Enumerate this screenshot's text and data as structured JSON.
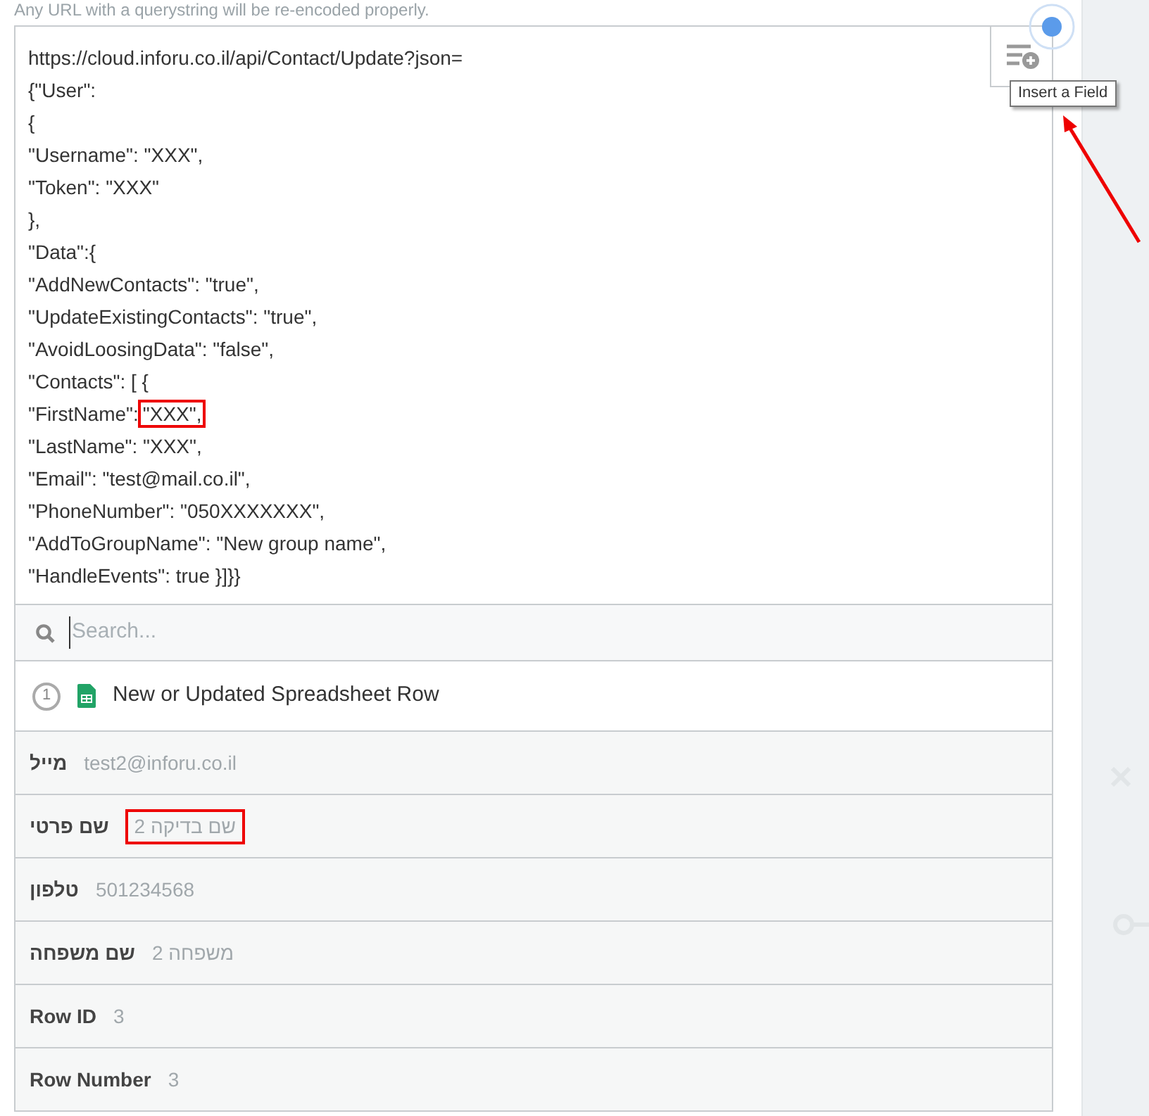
{
  "hint": "Any URL with a querystring will be re-encoded properly.",
  "editor": {
    "lines": [
      {
        "text": "https://cloud.inforu.co.il/api/Contact/Update?json="
      },
      {
        "text": "{\"User\":"
      },
      {
        "text": "{"
      },
      {
        "text": "\"Username\": \"XXX\","
      },
      {
        "text": "\"Token\": \"XXX\""
      },
      {
        "text": "},"
      },
      {
        "text": "\"Data\":{"
      },
      {
        "text": "\"AddNewContacts\": \"true\","
      },
      {
        "text": "\"UpdateExistingContacts\": \"true\","
      },
      {
        "text": "\"AvoidLoosingData\": \"false\","
      },
      {
        "text": "\"Contacts\": [ {"
      },
      {
        "text": "\"FirstName\":",
        "highlight": "\"XXX\","
      },
      {
        "text": "\"LastName\": \"XXX\","
      },
      {
        "text": "\"Email\": \"test@mail.co.il\","
      },
      {
        "text": "\"PhoneNumber\": \"050XXXXXXX\","
      },
      {
        "text": "\"AddToGroupName\": \"New group name\","
      },
      {
        "text": "\"HandleEvents\": true }]}}"
      }
    ],
    "tooltip": "Insert a Field"
  },
  "search": {
    "placeholder": "Search..."
  },
  "step": {
    "number": "1",
    "title": "New or Updated Spreadsheet Row"
  },
  "fields": [
    {
      "label": "מייל",
      "value": "test2@inforu.co.il",
      "highlighted": false
    },
    {
      "label": "שם פרטי",
      "value": "שם בדיקה 2",
      "highlighted": true
    },
    {
      "label": "טלפון",
      "value": "501234568",
      "highlighted": false
    },
    {
      "label": "שם משפחה",
      "value": "משפחה 2",
      "highlighted": false
    },
    {
      "label": "Row ID",
      "value": "3",
      "highlighted": false
    },
    {
      "label": "Row Number",
      "value": "3",
      "highlighted": false
    }
  ]
}
